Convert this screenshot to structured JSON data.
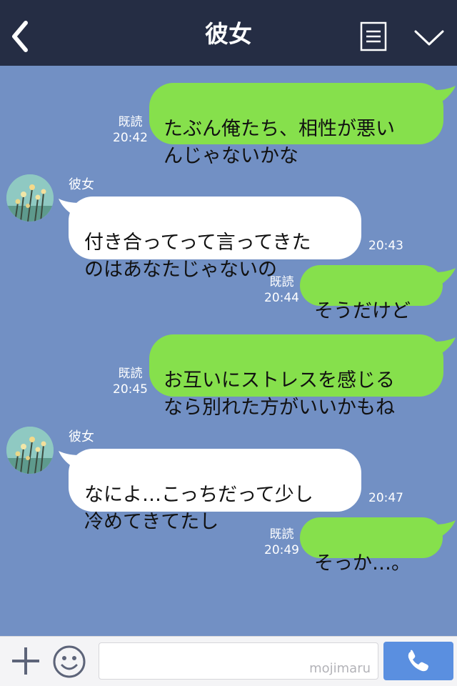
{
  "header": {
    "title": "彼女"
  },
  "messages": [
    {
      "sender": "me",
      "text": "たぶん俺たち、相性が悪い\nんじゃないかな",
      "read": "既読",
      "time": "20:42"
    },
    {
      "sender": "them",
      "name": "彼女",
      "text": "付き合ってって言ってきた\nのはあなたじゃないの",
      "time": "20:43"
    },
    {
      "sender": "me",
      "text": "そうだけど",
      "read": "既読",
      "time": "20:44"
    },
    {
      "sender": "me",
      "text": "お互いにストレスを感じる\nなら別れた方がいいかもね",
      "read": "既読",
      "time": "20:45"
    },
    {
      "sender": "them",
      "name": "彼女",
      "text": "なによ…こっちだって少し\n冷めてきてたし",
      "time": "20:47"
    },
    {
      "sender": "me",
      "text": "そっか…。",
      "read": "既読",
      "time": "20:49"
    }
  ],
  "footer": {
    "watermark": "mojimaru"
  },
  "colors": {
    "header_bg": "#252d44",
    "chat_bg": "#7290c4",
    "my_bubble": "#86e04c",
    "their_bubble": "#ffffff",
    "call_button": "#5a8fe0"
  },
  "icons": {
    "back": "chevron-left-icon",
    "menu": "list-icon",
    "collapse": "chevron-down-icon",
    "plus": "plus-icon",
    "emoji": "smiley-icon",
    "call": "phone-icon"
  }
}
